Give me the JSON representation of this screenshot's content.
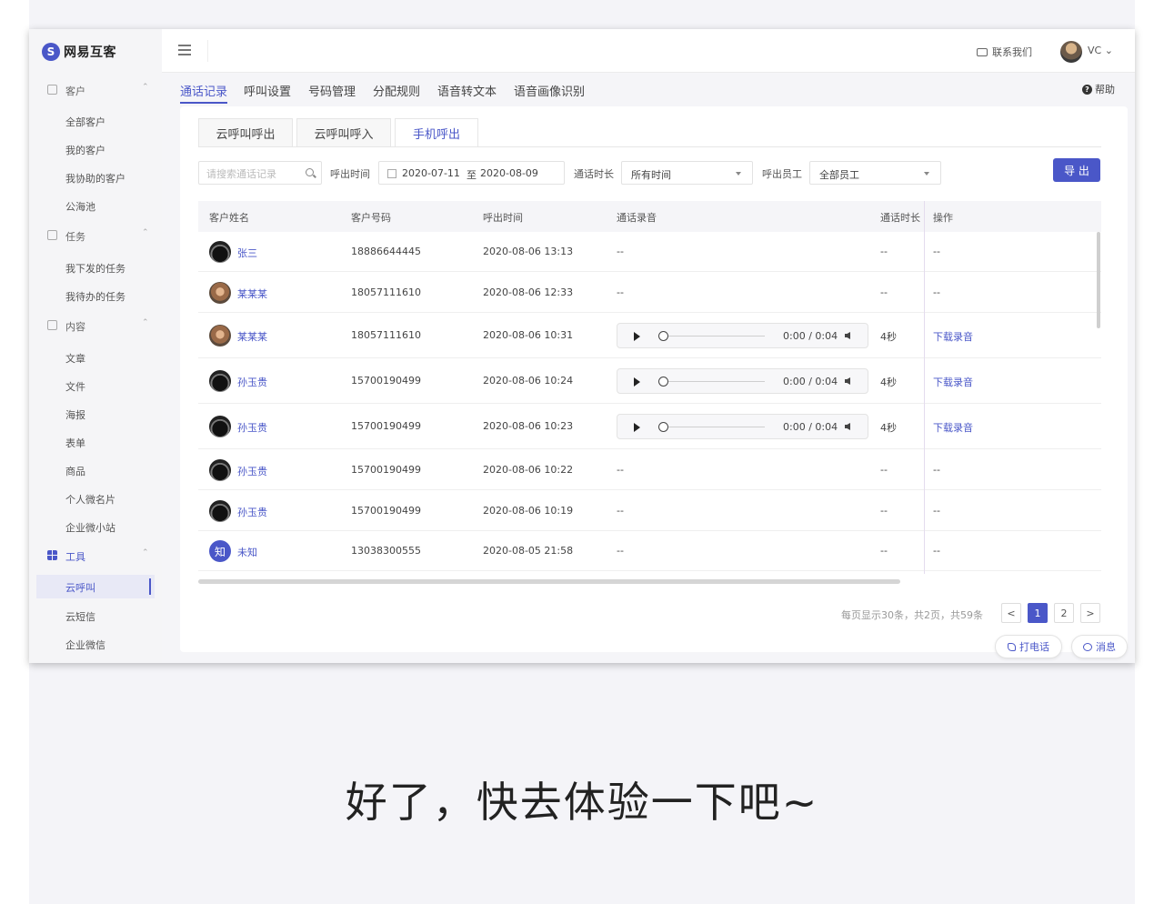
{
  "app": {
    "logo_text": "网易互客",
    "logo_mark": "S"
  },
  "header": {
    "contact_label": "联系我们",
    "user_name": "VC ⌄"
  },
  "sidebar": {
    "groups": [
      {
        "label": "客户",
        "chevron": "⌃",
        "items": [
          "全部客户",
          "我的客户",
          "我协助的客户",
          "公海池"
        ]
      },
      {
        "label": "任务",
        "chevron": "⌃",
        "items": [
          "我下发的任务",
          "我待办的任务"
        ]
      },
      {
        "label": "内容",
        "chevron": "⌃",
        "items": [
          "文章",
          "文件",
          "海报",
          "表单",
          "商品",
          "个人微名片",
          "企业微小站"
        ]
      },
      {
        "label": "工具",
        "chevron": "⌃",
        "items": [
          "云呼叫",
          "云短信",
          "企业微信"
        ]
      }
    ],
    "active_item": "云呼叫"
  },
  "main_tabs": [
    "通话记录",
    "呼叫设置",
    "号码管理",
    "分配规则",
    "语音转文本",
    "语音画像识别"
  ],
  "help": {
    "icon": "?",
    "label": "帮助"
  },
  "sub_tabs": [
    "云呼叫呼出",
    "云呼叫呼入",
    "手机呼出"
  ],
  "filters": {
    "search_placeholder": "请搜索通话记录",
    "call_time_label": "呼出时间",
    "date_from": "2020-07-11",
    "date_to_sep": "至",
    "date_to": "2020-08-09",
    "duration_label": "通话时长",
    "duration_value": "所有时间",
    "employee_label": "呼出员工",
    "employee_value": "全部员工",
    "export_label": "导 出"
  },
  "table": {
    "columns": [
      "客户姓名",
      "客户号码",
      "呼出时间",
      "通话录音",
      "通话时长",
      "操作"
    ],
    "rows": [
      {
        "avatar": "dark",
        "name": "张三",
        "phone": "18886644445",
        "time": "2020-08-06 13:13",
        "recording": "--",
        "duration": "--",
        "action": "--"
      },
      {
        "avatar": "dog",
        "name": "某某某",
        "phone": "18057111610",
        "time": "2020-08-06 12:33",
        "recording": "--",
        "duration": "--",
        "action": "--"
      },
      {
        "avatar": "dog",
        "name": "某某某",
        "phone": "18057111610",
        "time": "2020-08-06 10:31",
        "recording": "0:00 / 0:04",
        "duration": "4秒",
        "action": "下载录音"
      },
      {
        "avatar": "dark",
        "name": "孙玉贵",
        "phone": "15700190499",
        "time": "2020-08-06 10:24",
        "recording": "0:00 / 0:04",
        "duration": "4秒",
        "action": "下载录音"
      },
      {
        "avatar": "dark",
        "name": "孙玉贵",
        "phone": "15700190499",
        "time": "2020-08-06 10:23",
        "recording": "0:00 / 0:04",
        "duration": "4秒",
        "action": "下载录音"
      },
      {
        "avatar": "dark",
        "name": "孙玉贵",
        "phone": "15700190499",
        "time": "2020-08-06 10:22",
        "recording": "--",
        "duration": "--",
        "action": "--"
      },
      {
        "avatar": "dark",
        "name": "孙玉贵",
        "phone": "15700190499",
        "time": "2020-08-06 10:19",
        "recording": "--",
        "duration": "--",
        "action": "--"
      },
      {
        "avatar": "zhi",
        "avatar_text": "知",
        "name": "未知",
        "phone": "13038300555",
        "time": "2020-08-05 21:58",
        "recording": "--",
        "duration": "--",
        "action": "--"
      }
    ]
  },
  "pagination": {
    "info": "每页显示30条，共2页，共59条",
    "prev": "<",
    "pages": [
      "1",
      "2"
    ],
    "current": "1",
    "next": ">"
  },
  "floating": {
    "call_label": "打电话",
    "message_label": "消息"
  },
  "caption": "好了，快去体验一下吧~"
}
